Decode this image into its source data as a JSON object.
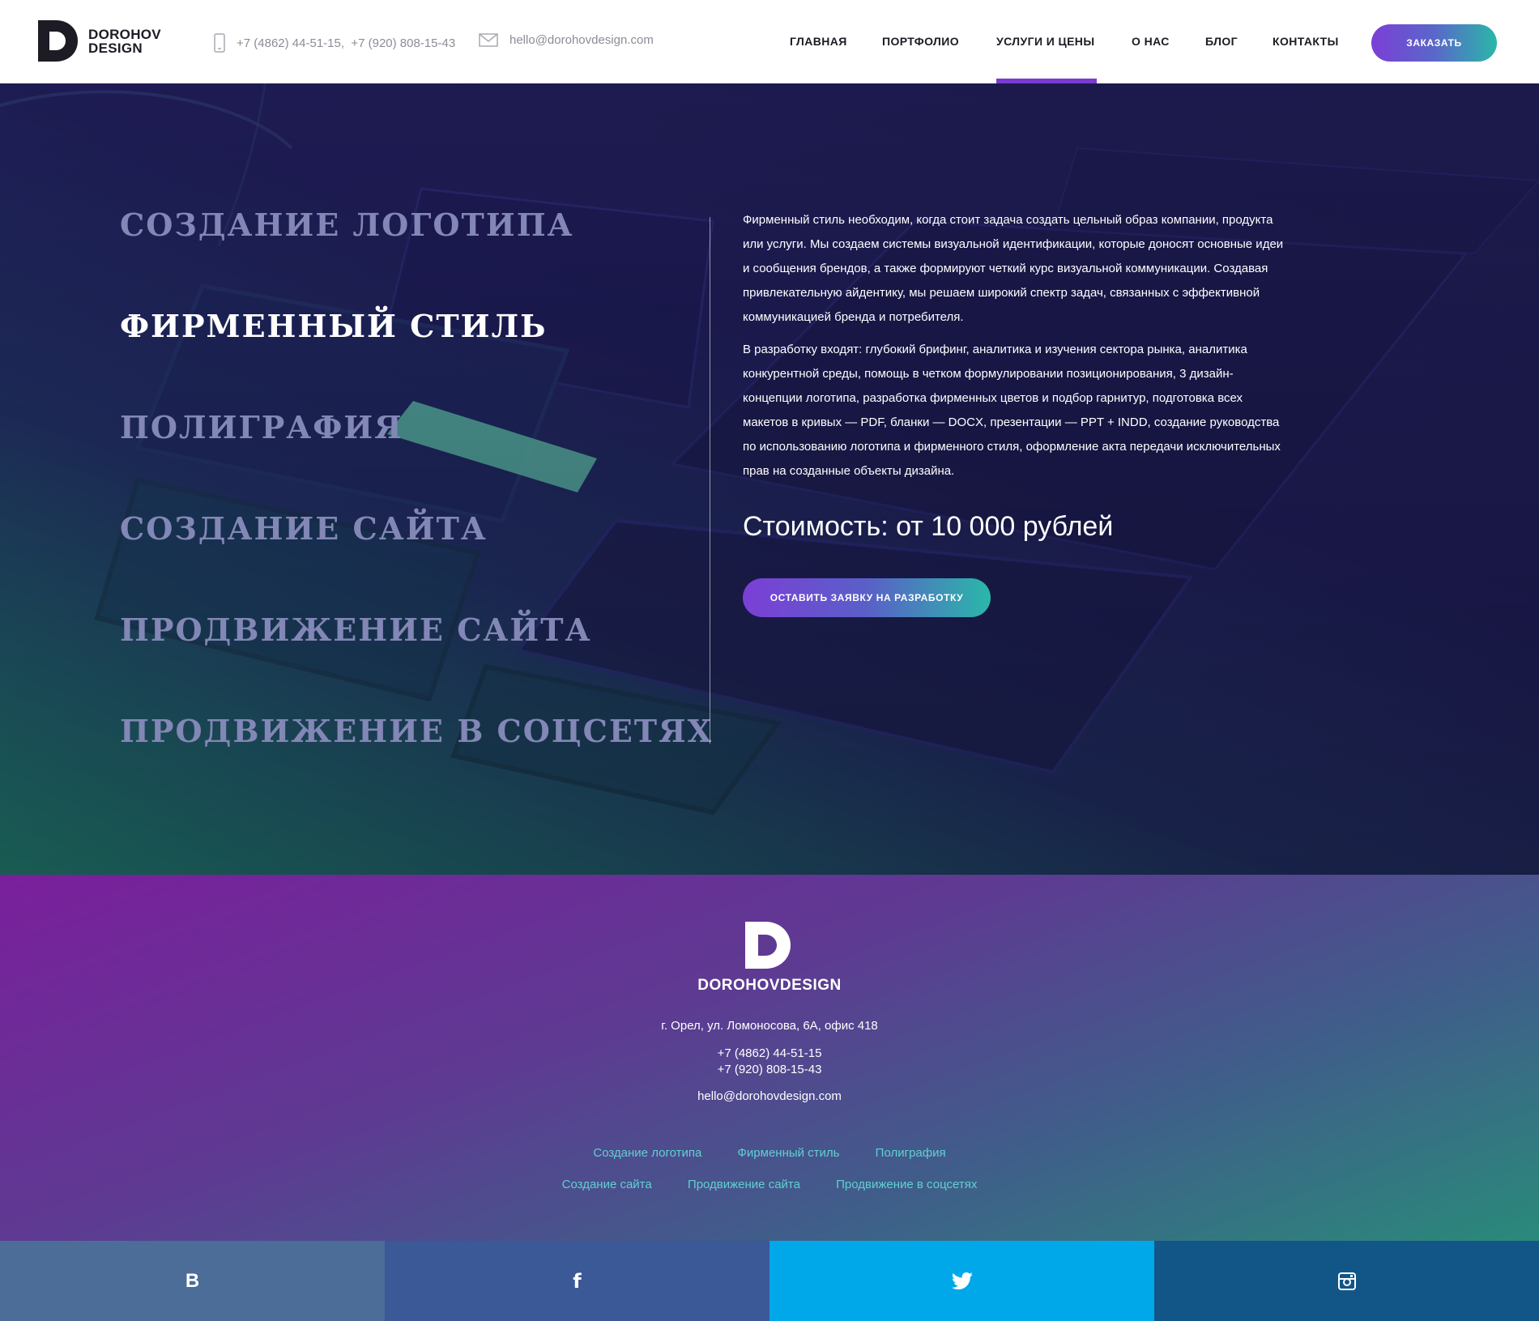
{
  "header": {
    "brand_line1": "DOROHOV",
    "brand_line2": "DESIGN",
    "phones": "+7 (4862) 44-51-15,  +7 (920) 808-15-43",
    "email": "hello@dorohovdesign.com",
    "nav": [
      "ГЛАВНАЯ",
      "ПОРТФОЛИО",
      "УСЛУГИ И ЦЕНЫ",
      "О НАС",
      "БЛОГ",
      "КОНТАКТЫ"
    ],
    "active_nav": "УСЛУГИ И ЦЕНЫ",
    "order_label": "ЗАКАЗАТЬ"
  },
  "hero": {
    "services": [
      "СОЗДАНИЕ ЛОГОТИПА",
      "ФИРМЕННЫЙ СТИЛЬ",
      "ПОЛИГРАФИЯ",
      "СОЗДАНИЕ САЙТА",
      "ПРОДВИЖЕНИЕ САЙТА",
      "ПРОДВИЖЕНИЕ В СОЦСЕТЯХ"
    ],
    "active_service": "ФИРМЕННЫЙ СТИЛЬ",
    "paragraph1": "Фирменный стиль необходим, когда стоит задача создать цельный образ компании, продукта или услуги. Мы создаем системы визуальной идентификации, которые доносят основные идеи и сообщения брендов, а также формируют четкий курс визуальной коммуникации. Создавая привлекательную айдентику, мы решаем широкий спектр задач, связанных с эффективной коммуникацией бренда и потребителя.",
    "paragraph2": "В разработку входят: глубокий брифинг, аналитика и изучения сектора рынка, аналитика конкурентной среды, помощь в четком формулировании позиционирования, 3 дизайн-концепции логотипа, разработка фирменных цветов и подбор гарнитур, подготовка всех макетов в кривых — PDF, бланки — DOCX, презентации — PPT + INDD, создание руководства по использованию логотипа и фирменного стиля, оформление акта передачи исключительных прав на созданные объекты дизайна.",
    "price": "Стоимость: от 10 000 рублей",
    "apply_label": "ОСТАВИТЬ ЗАЯВКУ НА РАЗРАБОТКУ"
  },
  "footer": {
    "brand": "DOROHOVDESIGN",
    "address": "г. Орел, ул. Ломоносова, 6А, офис 418",
    "phone1": "+7 (4862) 44-51-15",
    "phone2": "+7 (920) 808-15-43",
    "email": "hello@dorohovdesign.com",
    "links_row1": [
      "Создание логотипа",
      "Фирменный стиль",
      "Полиграфия"
    ],
    "links_row2": [
      "Создание сайта",
      "Продвижение сайта",
      "Продвижение в соцсетях"
    ]
  },
  "social": {
    "vk_icon": "vk-icon",
    "fb_icon": "facebook-icon",
    "tw_icon": "twitter-icon",
    "ig_icon": "instagram-icon",
    "vk_glyph": "В",
    "fb_glyph": "f"
  },
  "colors": {
    "accent_purple": "#7b3fd6",
    "accent_teal": "#2ab7a9",
    "vk": "#4b6d98",
    "facebook": "#3b5897",
    "twitter": "#00a8ea",
    "instagram": "#125688"
  }
}
